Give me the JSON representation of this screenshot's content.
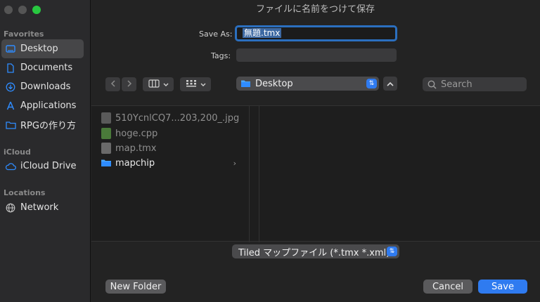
{
  "window": {
    "title": "ファイルに名前をつけて保存"
  },
  "sidebar": {
    "sections": [
      {
        "label": "Favorites"
      },
      {
        "label": "iCloud"
      },
      {
        "label": "Locations"
      }
    ],
    "favorites": [
      {
        "label": "Desktop",
        "icon": "desktop-icon",
        "selected": true
      },
      {
        "label": "Documents",
        "icon": "document-icon"
      },
      {
        "label": "Downloads",
        "icon": "download-icon"
      },
      {
        "label": "Applications",
        "icon": "applications-icon"
      },
      {
        "label": "RPGの作り方",
        "icon": "folder-icon"
      }
    ],
    "icloud": [
      {
        "label": "iCloud Drive",
        "icon": "cloud-icon"
      }
    ],
    "locations": [
      {
        "label": "Network",
        "icon": "globe-icon"
      }
    ]
  },
  "form": {
    "save_as_label": "Save As:",
    "save_as_value": "無題.tmx",
    "tags_label": "Tags:"
  },
  "toolbar": {
    "location": "Desktop",
    "search_placeholder": "Search"
  },
  "files": [
    {
      "name": "510YcnlCQ7...203,200_.jpg",
      "type": "image"
    },
    {
      "name": "hoge.cpp",
      "type": "cpp"
    },
    {
      "name": "map.tmx",
      "type": "tmx"
    },
    {
      "name": "mapchip",
      "type": "folder"
    }
  ],
  "format": {
    "selected": "Tiled マップファイル (*.tmx *.xml)"
  },
  "buttons": {
    "new_folder": "New Folder",
    "cancel": "Cancel",
    "save": "Save"
  },
  "colors": {
    "accent": "#2f7bf0",
    "folder": "#2f8cff"
  }
}
